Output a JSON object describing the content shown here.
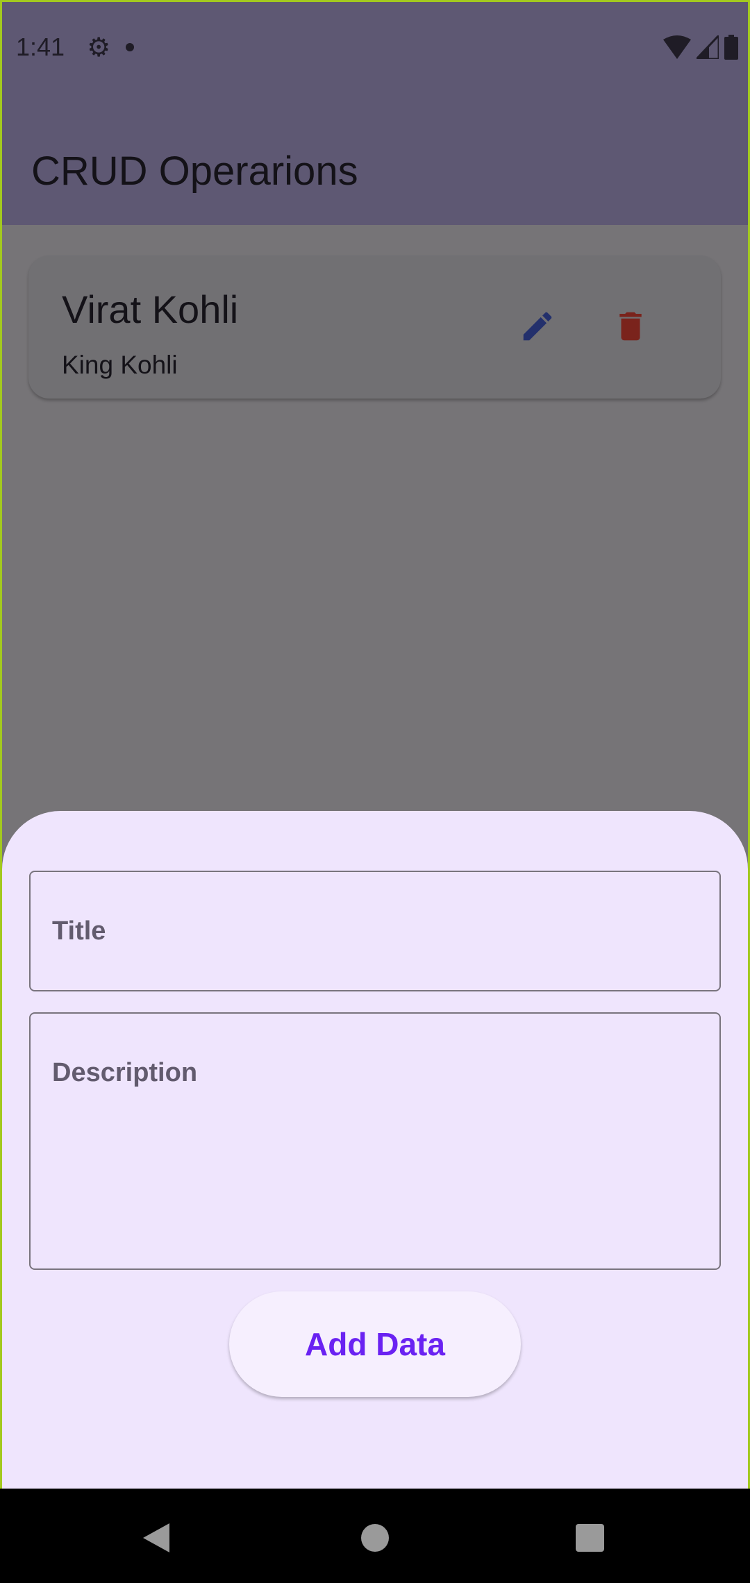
{
  "status_bar": {
    "time": "1:41"
  },
  "app_bar": {
    "title": "CRUD Operarions"
  },
  "items": [
    {
      "title": "Virat Kohli",
      "description": "King Kohli"
    }
  ],
  "sheet": {
    "title_placeholder": "Title",
    "description_placeholder": "Description",
    "add_button": "Add Data"
  },
  "colors": {
    "app_bar": "#5e5873",
    "edit_icon": "#23306c",
    "delete_icon": "#7a231c",
    "accent": "#6a22f2",
    "sheet": "#efe5fd"
  }
}
